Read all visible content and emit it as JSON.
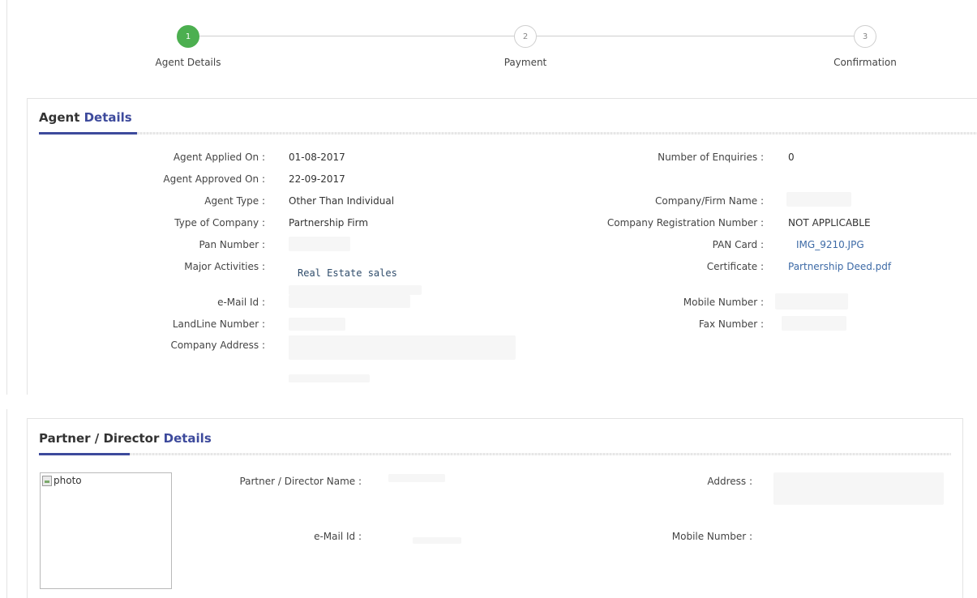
{
  "stepper": {
    "steps": [
      {
        "number": "1",
        "label": "Agent Details"
      },
      {
        "number": "2",
        "label": "Payment"
      },
      {
        "number": "3",
        "label": "Confirmation"
      }
    ],
    "active_step": 1
  },
  "agent_details": {
    "title_main": "Agent",
    "title_accent": "Details",
    "left": [
      {
        "label": "Agent Applied On :",
        "value": "01-08-2017"
      },
      {
        "label": "Agent Approved On :",
        "value": "22-09-2017"
      },
      {
        "label": "Agent Type  :",
        "value": "Other Than Individual"
      },
      {
        "label": "Type of Company :",
        "value": "Partnership Firm"
      },
      {
        "label": "Pan Number :",
        "value": ""
      },
      {
        "label": "Major Activities :",
        "value": "Real Estate sales"
      },
      {
        "label": "e-Mail Id :",
        "value": ""
      },
      {
        "label": "LandLine Number :",
        "value": ""
      },
      {
        "label": "Company Address :",
        "value": ""
      }
    ],
    "right": [
      {
        "label": "Number of Enquiries :",
        "value": "0"
      },
      {
        "label": "Company/Firm Name :",
        "value": ""
      },
      {
        "label": "Company Registration Number  :",
        "value": "NOT APPLICABLE"
      },
      {
        "label": "PAN Card  :",
        "value": "IMG_9210.JPG"
      },
      {
        "label": "Certificate :",
        "value": "Partnership Deed.pdf"
      },
      {
        "label": "Mobile Number :",
        "value": ""
      },
      {
        "label": "Fax Number :",
        "value": ""
      }
    ]
  },
  "partner_details": {
    "title_main": "Partner / Director",
    "title_accent": "Details",
    "photo_alt": "photo",
    "name_label": "Partner / Director Name  :",
    "email_label": "e-Mail Id :",
    "address_label": "Address :",
    "mobile_label": "Mobile Number :"
  },
  "colors": {
    "active_step": "#4caf50",
    "accent": "#3d4a9c",
    "link": "#3d6aa6"
  }
}
